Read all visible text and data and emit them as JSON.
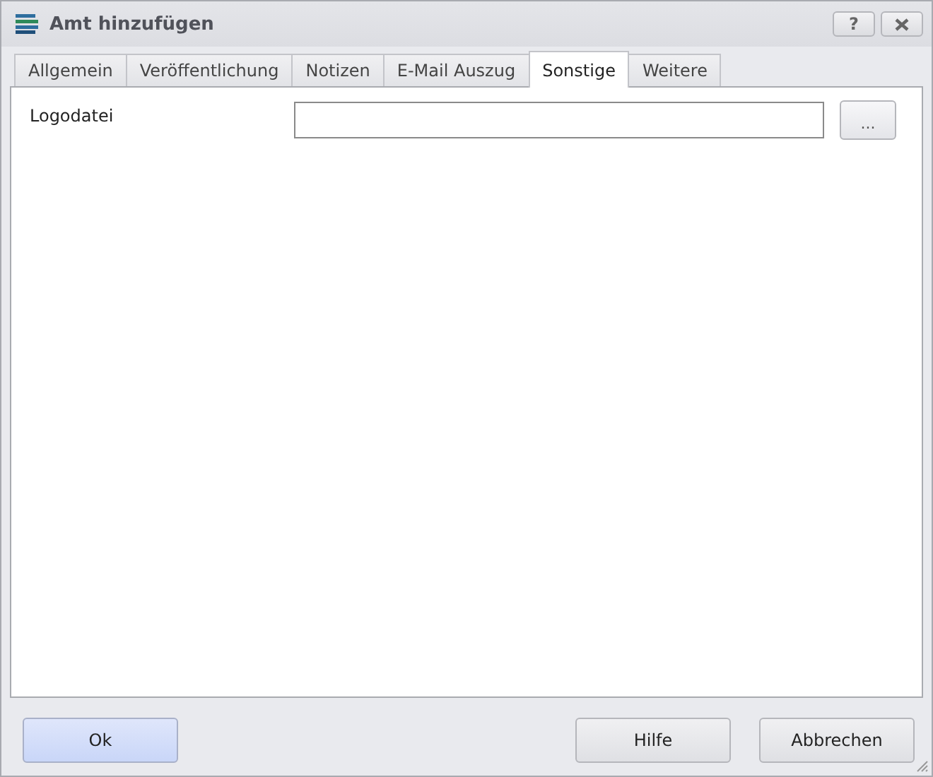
{
  "window": {
    "title": "Amt hinzufügen",
    "help_button": "?"
  },
  "tabs": [
    {
      "label": "Allgemein",
      "selected": false
    },
    {
      "label": "Veröffentlichung",
      "selected": false
    },
    {
      "label": "Notizen",
      "selected": false
    },
    {
      "label": "E-Mail Auszug",
      "selected": false
    },
    {
      "label": "Sonstige",
      "selected": true
    },
    {
      "label": "Weitere",
      "selected": false
    }
  ],
  "fields": [
    {
      "label": "Logodatei",
      "browse_button": "..."
    }
  ],
  "buttons": [
    {
      "label": "Ok",
      "default": true
    },
    {
      "label": "Hilfe",
      "default": false
    },
    {
      "label": "Abbrechen",
      "default": false
    }
  ]
}
